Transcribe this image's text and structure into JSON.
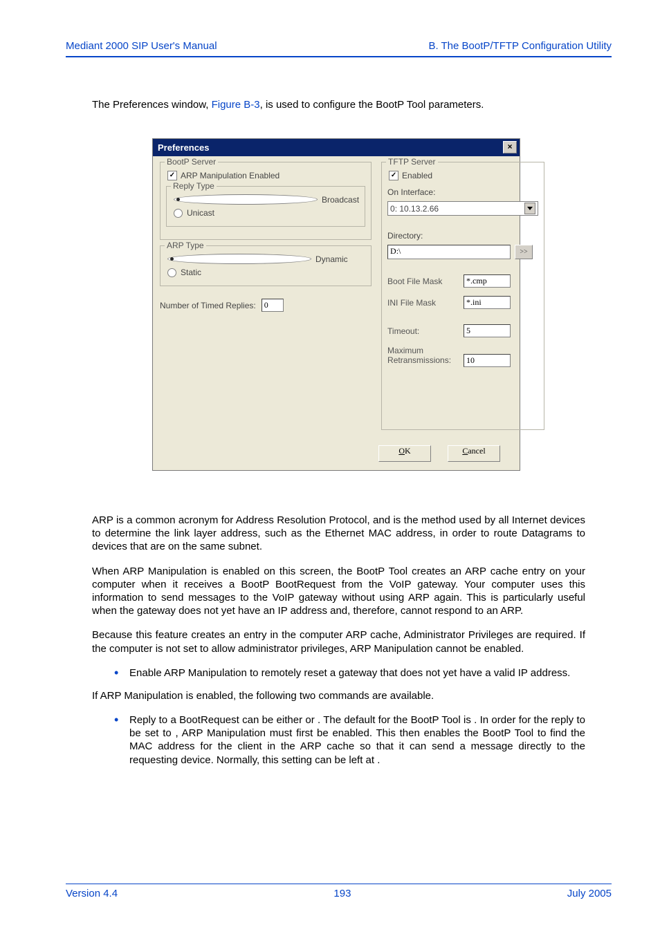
{
  "header": {
    "left": "Mediant 2000 SIP User's Manual",
    "right": "B. The BootP/TFTP Configuration Utility"
  },
  "intro": {
    "pre": "The Preferences window, ",
    "link": "Figure B-3",
    "post": ", is used to configure the BootP Tool parameters."
  },
  "window": {
    "title": "Preferences",
    "bootp": {
      "title": "BootP Server",
      "arp_label": "ARP Manipulation Enabled",
      "arp_checked": "✓",
      "reply_title": "Reply Type",
      "broadcast": "Broadcast",
      "unicast": "Unicast",
      "arp_type_title": "ARP Type",
      "dynamic": "Dynamic",
      "static": "Static",
      "timed_replies_label": "Number of Timed Replies:",
      "timed_replies_value": "0"
    },
    "tftp": {
      "title": "TFTP Server",
      "enabled_label": "Enabled",
      "enabled_checked": "✓",
      "on_interface": "On Interface:",
      "interface_value": "0: 10.13.2.66",
      "directory_label": "Directory:",
      "directory_value": "D:\\",
      "boot_mask_label": "Boot File Mask",
      "boot_mask_value": "*.cmp",
      "ini_mask_label": "INI File Mask",
      "ini_mask_value": "*.ini",
      "timeout_label": "Timeout:",
      "timeout_value": "5",
      "retrans_label1": "Maximum",
      "retrans_label2": "Retransmissions:",
      "retrans_value": "10",
      "browse": ">>"
    },
    "ok": "OK",
    "cancel": "Cancel"
  },
  "body": {
    "p1": "ARP is a common acronym for Address Resolution Protocol, and is the method used by all Internet devices to determine the link layer address, such as the Ethernet MAC address, in order to route Datagrams to devices that are on the same subnet.",
    "p2": "When ARP Manipulation is enabled on this screen, the BootP Tool creates an ARP cache entry on your computer when it receives a BootP BootRequest from the VoIP gateway. Your computer uses this information to send messages to the VoIP gateway without using ARP again. This is particularly useful when the gateway does not yet have an IP address and, therefore, cannot respond to an ARP.",
    "p3": "Because this feature creates an entry in the computer ARP cache, Administrator Privileges are required. If the computer is not set to allow administrator privileges, ARP Manipulation cannot be enabled.",
    "b1": "Enable ARP Manipulation to remotely reset a gateway that does not yet have a valid IP address.",
    "p4": "If ARP Manipulation is enabled, the following two commands are available.",
    "b2": "Reply to a BootRequest can be either                  or             . The default for the BootP Tool is                 . In order for the reply to be set to              , ARP Manipulation must first be enabled. This then enables the BootP Tool to find the MAC address for the client in the ARP cache so that it can send a message directly to the requesting device. Normally, this setting can be left at                 ."
  },
  "footer": {
    "version": "Version 4.4",
    "page": "193",
    "date": "July 2005"
  }
}
